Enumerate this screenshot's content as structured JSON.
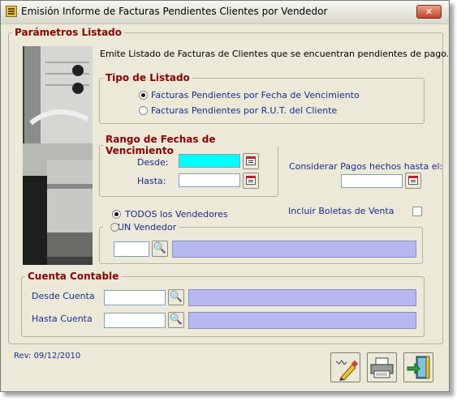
{
  "window": {
    "title": "Emisión Informe de Facturas Pendientes Clientes por Vendedor",
    "close_label": "✕"
  },
  "params": {
    "legend": "Parámetros Listado",
    "description": "Emite Listado de Facturas de Clientes que se encuentran pendientes de pago."
  },
  "tipo": {
    "legend": "Tipo de Listado",
    "option1": "Facturas Pendientes por Fecha de Vencimiento",
    "option2": "Facturas Pendientes por R.U.T. del Cliente",
    "selected": "option1"
  },
  "rango": {
    "legend": "Rango de Fechas de Vencimiento",
    "desde_label": "Desde:",
    "hasta_label": "Hasta:",
    "desde_value": "",
    "hasta_value": ""
  },
  "pagos": {
    "label": "Considerar Pagos hechos hasta el:",
    "value": ""
  },
  "boletas": {
    "label": "Incluir Boletas de Venta",
    "checked": false
  },
  "vendedores": {
    "todos_label": "TODOS los Vendedores",
    "un_label": "UN Vendedor",
    "selected": "todos",
    "code_value": "",
    "name_value": ""
  },
  "cuenta": {
    "legend": "Cuenta Contable",
    "desde_label": "Desde Cuenta",
    "hasta_label": "Hasta Cuenta",
    "desde_value": "",
    "hasta_value": ""
  },
  "footer": {
    "revision": "Rev: 09/12/2010"
  },
  "icons": {
    "calendar": "calendar-icon",
    "search": "binoculars-icon",
    "report": "report-pen-icon",
    "print": "printer-icon",
    "exit": "exit-door-icon"
  },
  "colors": {
    "legend": "#8b0000",
    "label_blue": "#1a2d8a",
    "date_highlight": "#00ffff",
    "name_field": "#b8b8f0"
  }
}
